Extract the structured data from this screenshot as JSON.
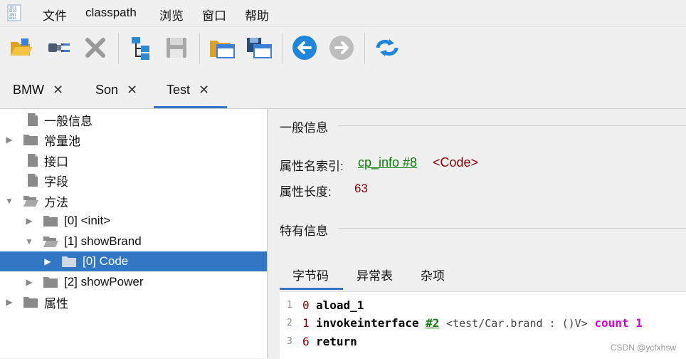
{
  "menu": [
    "文件",
    "classpath",
    "浏览",
    "窗口",
    "帮助"
  ],
  "toolbar": {
    "icons": [
      "open-folder-icon",
      "plugin-icon",
      "close-x-icon",
      "tree-icon",
      "save-disk-icon",
      "open-window-icon",
      "save-window-icon",
      "back-arrow-icon",
      "forward-arrow-icon",
      "refresh-icon"
    ]
  },
  "tabs": [
    {
      "label": "BMW",
      "close": "✕"
    },
    {
      "label": "Son",
      "close": "✕"
    },
    {
      "label": "Test",
      "close": "✕"
    }
  ],
  "tree": {
    "items": [
      {
        "label": "一般信息"
      },
      {
        "label": "常量池"
      },
      {
        "label": "接口"
      },
      {
        "label": "字段"
      },
      {
        "label": "方法"
      },
      {
        "label": "[0] <init>"
      },
      {
        "label": "[1] showBrand"
      },
      {
        "label": "[0] Code"
      },
      {
        "label": "[2] showPower"
      },
      {
        "label": "属性"
      }
    ]
  },
  "detail": {
    "general_title": "一般信息",
    "name_index_label": "属性名索引:",
    "name_index_link": "cp_info #8",
    "name_index_value": "<Code>",
    "length_label": "属性长度:",
    "length_value": "63",
    "specific_title": "特有信息",
    "subtabs": [
      "字节码",
      "异常表",
      "杂项"
    ]
  },
  "bytecode": [
    {
      "line": "1",
      "offset": "0",
      "instr": "aload_1"
    },
    {
      "line": "2",
      "offset": "1",
      "instr": "invokeinterface",
      "ref": "#2",
      "desc": "<test/Car.brand : ()V>",
      "kw": "count",
      "count": "1"
    },
    {
      "line": "3",
      "offset": "6",
      "instr": "return"
    }
  ],
  "watermark": "CSDN @ycfxhsw",
  "colors": {
    "accent": "#3574c4",
    "selection": "#3276c6",
    "link": "#0a7a0a",
    "value": "#8b0000",
    "keyword": "#d400d4"
  }
}
